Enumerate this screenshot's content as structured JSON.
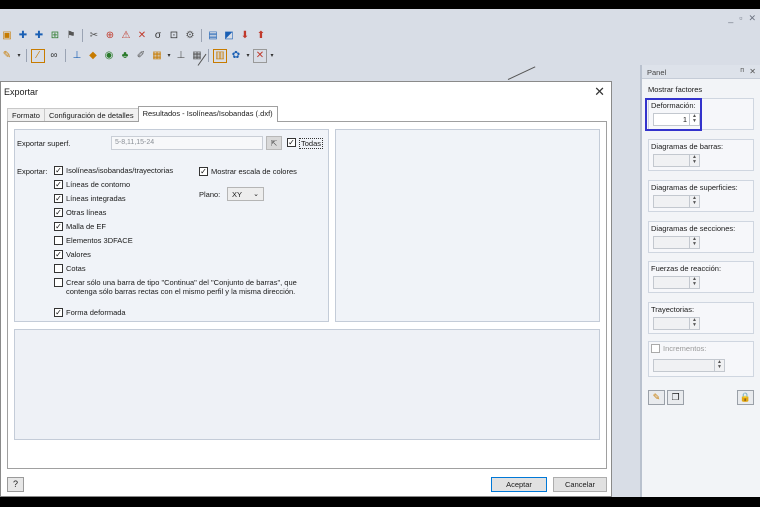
{
  "dialog": {
    "title": "Exportar",
    "tabs": [
      "Formato",
      "Configuración de detalles",
      "Resultados - Isolíneas/Isobandas (.dxf)"
    ],
    "export_surface_label": "Exportar superf.",
    "export_surface_value": "5-8,11,15-24",
    "all_label": "Todas",
    "export_label": "Exportar:",
    "options": [
      {
        "label": "Isolíneas/isobandas/trayectorias",
        "checked": true
      },
      {
        "label": "Líneas de contorno",
        "checked": true
      },
      {
        "label": "Líneas integradas",
        "checked": true
      },
      {
        "label": "Otras líneas",
        "checked": true
      },
      {
        "label": "Malla de EF",
        "checked": true
      },
      {
        "label": "Elementos 3DFACE",
        "checked": false
      },
      {
        "label": "Valores",
        "checked": true
      },
      {
        "label": "Cotas",
        "checked": false
      },
      {
        "label": "Crear sólo una barra de tipo \"Continua\" del \"Conjunto de barras\", que contenga sólo barras rectas con el mismo perfil y la misma dirección.",
        "checked": false
      }
    ],
    "deformed_label": "Forma deformada",
    "color_scale_label": "Mostrar escala de colores",
    "plane_label": "Plano:",
    "plane_value": "XY",
    "ok": "Aceptar",
    "cancel": "Cancelar"
  },
  "panel": {
    "title": "Panel",
    "pin": "ᴨ",
    "close": "✕",
    "subtitle": "Mostrar factores",
    "groups": [
      {
        "label": "Deformación:",
        "value": "1"
      },
      {
        "label": "Diagramas de barras:",
        "value": ""
      },
      {
        "label": "Diagramas de superficies:",
        "value": ""
      },
      {
        "label": "Diagramas de secciones:",
        "value": ""
      },
      {
        "label": "Fuerzas de reacción:",
        "value": ""
      },
      {
        "label": "Trayectorias:",
        "value": ""
      }
    ],
    "increments_label": "Incrementos:"
  },
  "window_controls": [
    "_",
    "▫",
    "✕"
  ]
}
